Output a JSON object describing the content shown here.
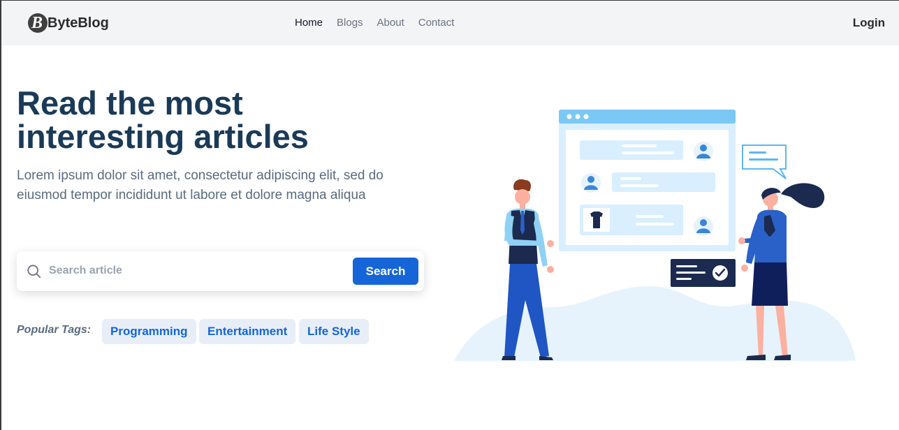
{
  "header": {
    "logo_letter": "B",
    "brand": "ByteBlog",
    "nav": [
      {
        "label": "Home",
        "active": true
      },
      {
        "label": "Blogs",
        "active": false
      },
      {
        "label": "About",
        "active": false
      },
      {
        "label": "Contact",
        "active": false
      }
    ],
    "login_label": "Login"
  },
  "hero": {
    "title_line1": "Read the most",
    "title_line2": "interesting articles",
    "subtitle": "Lorem ipsum dolor sit amet, consectetur adipiscing elit, sed do eiusmod tempor incididunt ut labore et dolore magna aliqua",
    "search": {
      "icon": "search-icon",
      "placeholder": "Search article",
      "value": "",
      "button_label": "Search"
    },
    "tags_label": "Popular Tags:",
    "tags": [
      "Programming",
      "Entertainment",
      "Life Style"
    ]
  },
  "colors": {
    "primary": "#1565d8",
    "heading": "#1a3a57",
    "body_text": "#5a6b7e",
    "tag_bg": "#e8eef7",
    "navbar_bg": "#f3f4f6"
  }
}
